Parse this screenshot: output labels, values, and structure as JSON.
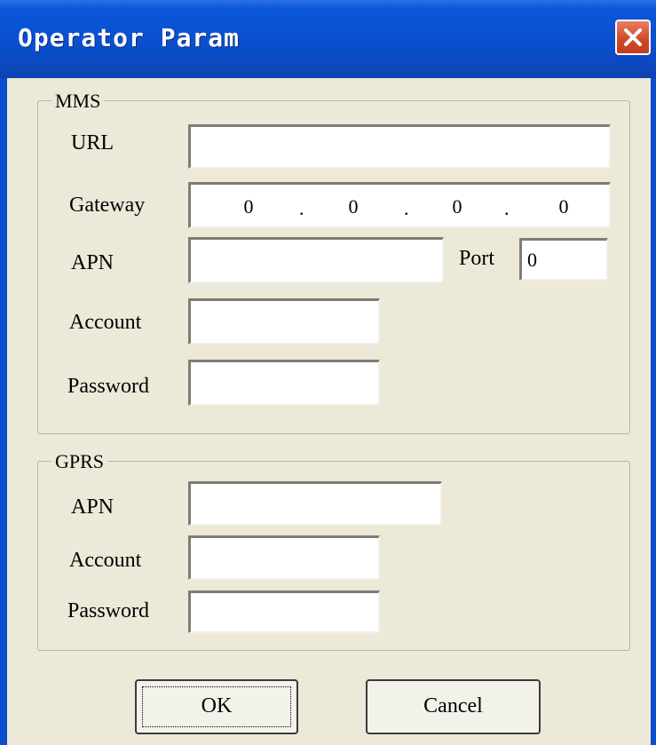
{
  "window": {
    "title": "Operator Param"
  },
  "mms": {
    "legend": "MMS",
    "url": {
      "label": "URL",
      "value": ""
    },
    "gateway": {
      "label": "Gateway",
      "octets": [
        "0",
        "0",
        "0",
        "0"
      ],
      "separator": "."
    },
    "apn": {
      "label": "APN",
      "value": ""
    },
    "port": {
      "label": "Port",
      "value": "0"
    },
    "account": {
      "label": "Account",
      "value": ""
    },
    "password": {
      "label": "Password",
      "value": ""
    }
  },
  "gprs": {
    "legend": "GPRS",
    "apn": {
      "label": "APN",
      "value": ""
    },
    "account": {
      "label": "Account",
      "value": ""
    },
    "password": {
      "label": "Password",
      "value": ""
    }
  },
  "buttons": {
    "ok": "OK",
    "cancel": "Cancel"
  },
  "colors": {
    "titlebar": "#0a4fd0",
    "dialog_bg": "#ece9d8",
    "close_button": "#d24a2a"
  }
}
